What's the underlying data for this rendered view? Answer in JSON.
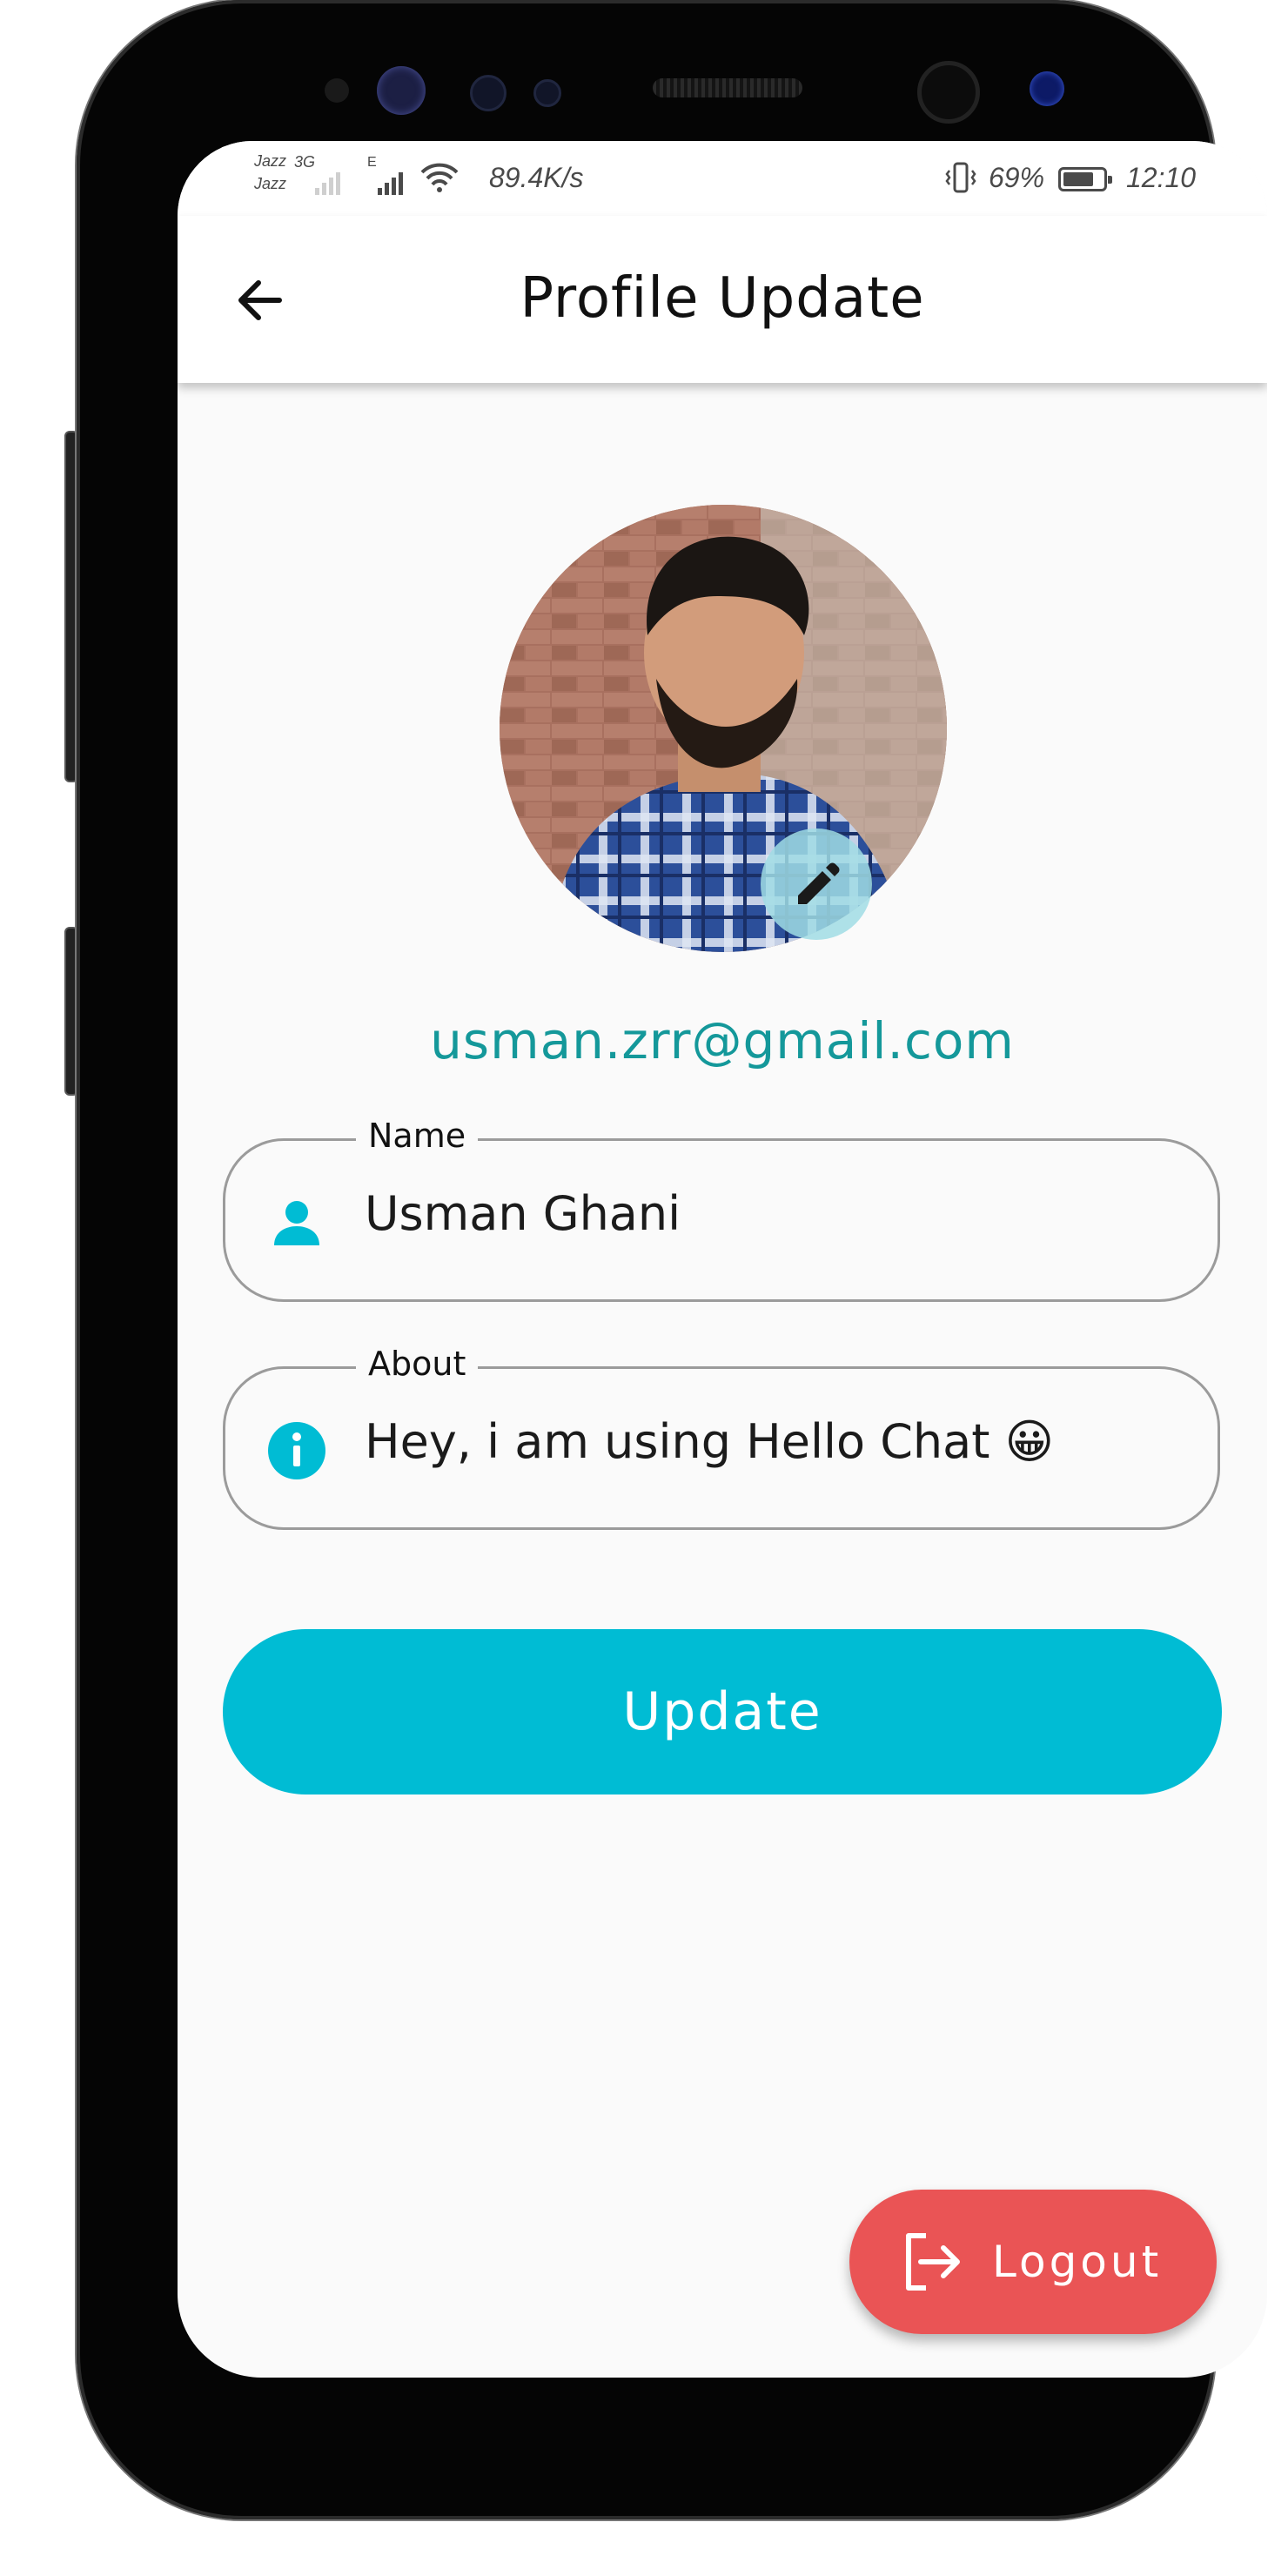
{
  "status_bar": {
    "carrier_1": "Jazz",
    "carrier_2": "Jazz",
    "network_type_1": "3G",
    "network_type_2": "E",
    "speed": "89.4K/s",
    "battery_percent": "69%",
    "time": "12:10",
    "icons": [
      "signal-icon",
      "wifi-icon",
      "vibrate-icon",
      "battery-icon"
    ]
  },
  "app_bar": {
    "title": "Profile Update",
    "back_icon": "arrow-back-icon"
  },
  "profile": {
    "avatar": "profile-photo",
    "edit_icon": "pencil-icon",
    "email": "usman.zrr@gmail.com"
  },
  "form": {
    "name": {
      "label": "Name",
      "value": "Usman Ghani",
      "icon": "person-icon"
    },
    "about": {
      "label": "About",
      "value": "Hey, i am using Hello Chat 😀",
      "icon": "info-icon"
    },
    "update_label": "Update"
  },
  "logout": {
    "label": "Logout",
    "icon": "logout-icon"
  },
  "colors": {
    "accent": "#00bcd4",
    "email": "#14989a",
    "logout": "#ea5455",
    "background": "#fafafa"
  }
}
